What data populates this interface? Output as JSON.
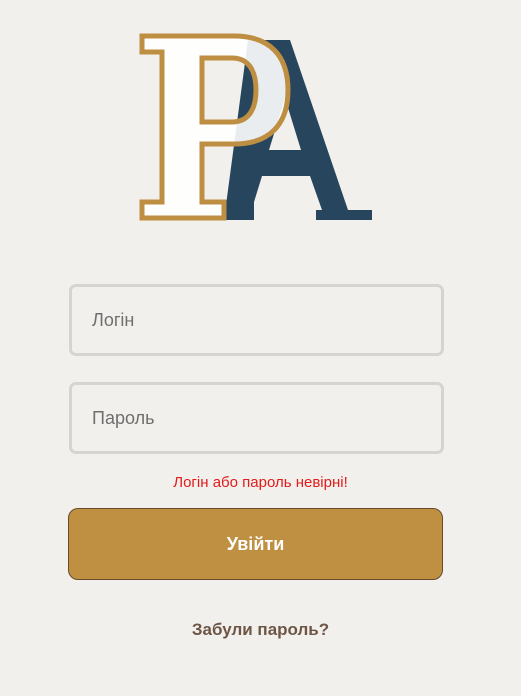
{
  "logo": {
    "name": "pa-monogram-logo",
    "colors": {
      "p_outline": "#be8e42",
      "p_fill": "#ffffff",
      "a_fill": "#27465e"
    }
  },
  "form": {
    "login_placeholder": "Логін",
    "password_placeholder": "Пароль",
    "error_message": "Логін або пароль невірні!",
    "submit_label": "Увійти",
    "forgot_label": "Забули пароль?"
  },
  "colors": {
    "background": "#f2f0ec",
    "accent": "#bf8f42",
    "error": "#e21b1b",
    "link": "#6e5646"
  }
}
